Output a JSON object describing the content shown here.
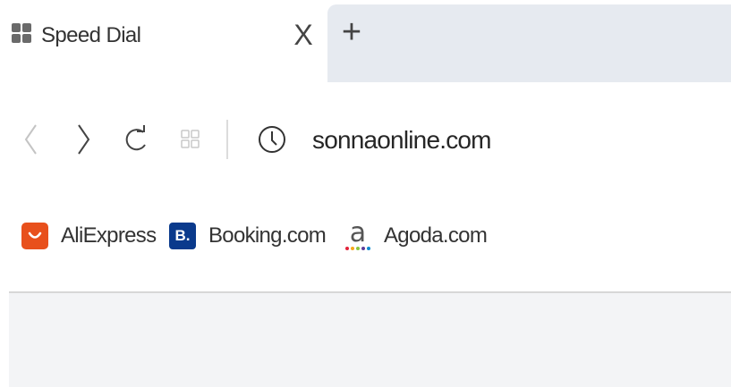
{
  "tab": {
    "title": "Speed Dial",
    "favicon": "speed-dial-grid-icon",
    "close_glyph": "X",
    "new_tab_glyph": "+"
  },
  "nav": {
    "address": "sonnaonline.com",
    "buttons": [
      "back-icon",
      "forward-icon",
      "reload-icon",
      "speed-dial-icon",
      "site-info-clock-icon"
    ]
  },
  "bookmarks": [
    {
      "label": "AliExpress",
      "icon": "aliexpress-icon",
      "color": "#e8501c"
    },
    {
      "label": "Booking.com",
      "icon": "booking-icon",
      "icon_text": "B.",
      "color": "#0a3a8c"
    },
    {
      "label": "Agoda.com",
      "icon": "agoda-icon",
      "icon_text": "a"
    }
  ],
  "colors": {
    "tabstrip_background": "#e6eaf0",
    "content_background": "#f3f4f6"
  }
}
